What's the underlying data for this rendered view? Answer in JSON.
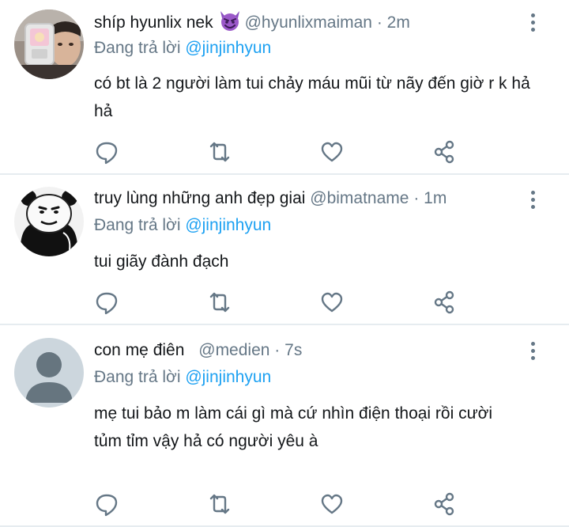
{
  "replies": [
    {
      "name": "shíp hyunlix nek",
      "emoji_icon": "smiling-imp-icon",
      "handle": "@hyunlixmaiman",
      "separator": "·",
      "time": "2m",
      "reply_label": "Đang trả lời",
      "reply_to": "@jinjinhyun",
      "text": "có bt là 2 người làm tui chảy máu mũi từ nãy đến giờ r k hả hả",
      "avatar_icon": "photo-avatar"
    },
    {
      "name": "truy lùng những anh đẹp giai",
      "handle": "@bimatname",
      "separator": "·",
      "time": "1m",
      "reply_label": "Đang trả lời",
      "reply_to": "@jinjinhyun",
      "text": "tui giãy đành đạch",
      "avatar_icon": "panda-meme-avatar"
    },
    {
      "name": "con mẹ điên",
      "handle": "@medien",
      "separator": "·",
      "time": "7s",
      "reply_label": "Đang trả lời",
      "reply_to": "@jinjinhyun",
      "text": "mẹ tui bảo m làm cái gì mà cứ nhìn điện thoại rồi cười tủm tỉm vậy hả có người yêu à",
      "avatar_icon": "default-avatar"
    }
  ],
  "action_icons": [
    "reply-icon",
    "retweet-icon",
    "like-icon",
    "share-icon"
  ],
  "colors": {
    "text": "#14171a",
    "secondary": "#657786",
    "mention": "#1da1f2",
    "divider": "#e6ecf0"
  }
}
